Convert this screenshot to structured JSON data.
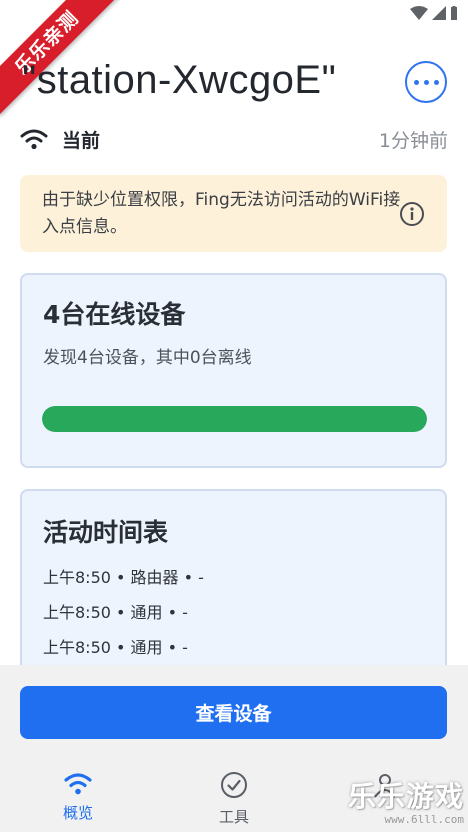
{
  "status_bar": {
    "icons": [
      "wifi-icon",
      "signal-icon",
      "battery-icon"
    ]
  },
  "badge": {
    "text": "乐乐亲测"
  },
  "network": {
    "title": "\"station-XwcgoE\"",
    "label": "当前",
    "time": "1分钟前"
  },
  "warning": {
    "text": "由于缺少位置权限，Fing无法访问活动的WiFi接入点信息。",
    "icon": "info-icon"
  },
  "devices_card": {
    "title": "4台在线设备",
    "subtitle": "发现4台设备，其中0台离线",
    "online_fraction": 1.0
  },
  "activity_card": {
    "title": "活动时间表",
    "items": [
      "上午8:50 • 路由器 • -",
      "上午8:50 • 通用 • -",
      "上午8:50 • 通用 • -"
    ]
  },
  "cta": {
    "label": "查看设备"
  },
  "nav": {
    "items": [
      {
        "label": "概览",
        "icon": "wifi-icon"
      },
      {
        "label": "工具",
        "icon": "check-circle-icon"
      },
      {
        "label": "",
        "icon": "person-icon"
      }
    ]
  },
  "watermark": {
    "title": "乐乐游戏",
    "url": "www.6lll.com"
  },
  "colors": {
    "accent": "#1f6ff0",
    "progress": "#27a85a",
    "warning_bg": "#fdf1d9",
    "badge": "#d81e2a"
  }
}
